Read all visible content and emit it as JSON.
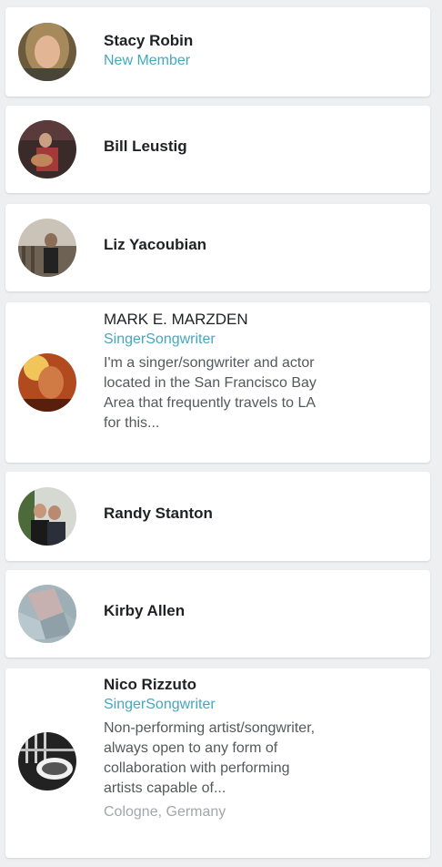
{
  "members": [
    {
      "name": "Stacy Robin",
      "role": "New Member",
      "avatar": "stacy-robin-avatar"
    },
    {
      "name": "Bill Leustig",
      "avatar": "bill-leustig-avatar"
    },
    {
      "name": "Liz Yacoubian",
      "avatar": "liz-yacoubian-avatar"
    },
    {
      "name": "MARK E. MARZDEN",
      "role": "SingerSongwriter",
      "bio": "I'm a singer/songwriter and actor located in the San Francisco Bay Area that frequently travels to LA for this...",
      "avatar": "mark-marzden-avatar"
    },
    {
      "name": "Randy Stanton",
      "avatar": "randy-stanton-avatar"
    },
    {
      "name": "Kirby Allen",
      "avatar": "kirby-allen-avatar"
    },
    {
      "name": "Nico Rizzuto",
      "role": "SingerSongwriter",
      "bio": "Non-performing artist/songwriter, always open to any form of collaboration with performing artists capable of...",
      "location": "Cologne, Germany",
      "avatar": "nico-rizzuto-avatar"
    }
  ],
  "colors": {
    "accent": "#45a8c0",
    "name": "#1f2125",
    "bio": "#55585c",
    "location": "#a3a6aa",
    "background": "#eeeff1"
  }
}
